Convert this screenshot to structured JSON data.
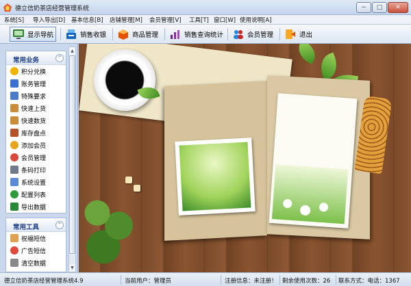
{
  "window": {
    "title": "德立信奶茶店经营管理系统",
    "controls": {
      "minimize": "−",
      "maximize": "□",
      "close": "✕"
    }
  },
  "menu": [
    "系统[S]",
    "导入导出[D]",
    "基本信息[B]",
    "店铺管理[M]",
    "会员管理[V]",
    "工具[T]",
    "窗口[W]",
    "使用说明[A]"
  ],
  "toolbar": [
    {
      "label": "显示导航",
      "icon": "monitor-nav-icon",
      "color": "#2e7d32"
    },
    {
      "label": "销售收银",
      "icon": "cash-register-icon",
      "color": "#1565c0"
    },
    {
      "label": "商品管理",
      "icon": "product-box-icon",
      "color": "#e65100"
    },
    {
      "label": "销售查询统计",
      "icon": "sales-chart-icon",
      "color": "#6a1b9a"
    },
    {
      "label": "会员管理",
      "icon": "members-icon",
      "color": "#c62828"
    },
    {
      "label": "退出",
      "icon": "exit-icon",
      "color": "#f9a825"
    }
  ],
  "sidebar": {
    "groups": [
      {
        "title": "常用业务",
        "items": [
          {
            "label": "积分兑换",
            "icon": "coin-icon",
            "color": "#f0b400"
          },
          {
            "label": "账务管理",
            "icon": "ledger-icon",
            "color": "#3b6fd1"
          },
          {
            "label": "特殊要求",
            "icon": "calendar-icon",
            "color": "#4a7bc8"
          },
          {
            "label": "快速上货",
            "icon": "box-up-icon",
            "color": "#c88c3a"
          },
          {
            "label": "快速数货",
            "icon": "box-count-icon",
            "color": "#c88c3a"
          },
          {
            "label": "库存盘点",
            "icon": "warehouse-icon",
            "color": "#b5542a"
          },
          {
            "label": "添加会员",
            "icon": "add-member-icon",
            "color": "#e8a31c"
          },
          {
            "label": "会员管理",
            "icon": "member-icon",
            "color": "#d84a3a"
          },
          {
            "label": "条码打印",
            "icon": "printer-icon",
            "color": "#6f7a8a"
          },
          {
            "label": "系统设置",
            "icon": "wrench-icon",
            "color": "#5a8ad4"
          },
          {
            "label": "配置列表",
            "icon": "check-icon",
            "color": "#2e9a3a"
          },
          {
            "label": "导出数据",
            "icon": "excel-icon",
            "color": "#2a8a3a"
          }
        ]
      },
      {
        "title": "常用工具",
        "items": [
          {
            "label": "祝福短信",
            "icon": "sms-gift-icon",
            "color": "#e0a050"
          },
          {
            "label": "广告短信",
            "icon": "sms-ad-icon",
            "color": "#e04a3a"
          },
          {
            "label": "清空数据",
            "icon": "clear-data-icon",
            "color": "#8a8a8a"
          }
        ]
      }
    ]
  },
  "status": {
    "system_name": "德立信奶茶店经营管理系统4.9",
    "current_user": "当前用户：管理员",
    "register_info": "注册信息：未注册！",
    "remaining": "剩余使用次数：26",
    "contact": "联系方式：电话：1367"
  }
}
